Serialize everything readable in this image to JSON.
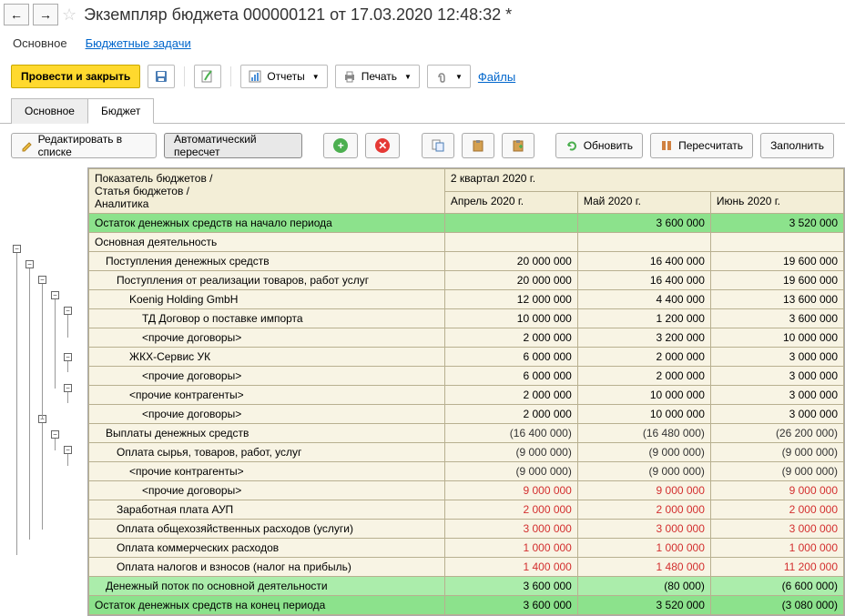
{
  "title": "Экземпляр бюджета 000000121 от 17.03.2020 12:48:32 *",
  "topNav": {
    "main": "Основное",
    "tasks": "Бюджетные задачи"
  },
  "toolbar1": {
    "submit": "Провести и закрыть",
    "reports": "Отчеты",
    "print": "Печать",
    "files": "Файлы"
  },
  "subTabs": {
    "main": "Основное",
    "budget": "Бюджет"
  },
  "toolbar2": {
    "editList": "Редактировать в списке",
    "autoRecalc": "Автоматический пересчет",
    "refresh": "Обновить",
    "recalc": "Пересчитать",
    "fill": "Заполнить"
  },
  "gridHeader": {
    "col1": "Показатель бюджетов /\nСтатья бюджетов /\nАналитика",
    "quarter": "2 квартал 2020 г.",
    "m1": "Апрель 2020 г.",
    "m2": "Май 2020 г.",
    "m3": "Июнь 2020 г."
  },
  "rows": [
    {
      "label": "Остаток денежных средств на начало периода",
      "cls": "row-green",
      "ind": 0,
      "v": [
        "",
        "3 600 000",
        "3 520 000"
      ]
    },
    {
      "label": "Основная деятельность",
      "cls": "row-beige",
      "ind": 0,
      "v": [
        "",
        "",
        ""
      ]
    },
    {
      "label": "Поступления денежных средств",
      "cls": "row-beige",
      "ind": 1,
      "v": [
        "20 000 000",
        "16 400 000",
        "19 600 000"
      ]
    },
    {
      "label": "Поступления от реализации товаров, работ услуг",
      "cls": "row-beige",
      "ind": 2,
      "v": [
        "20 000 000",
        "16 400 000",
        "19 600 000"
      ]
    },
    {
      "label": "Koenig Holding GmbH",
      "cls": "row-beige",
      "ind": 3,
      "v": [
        "12 000 000",
        "4 400 000",
        "13 600 000"
      ]
    },
    {
      "label": "ТД Договор о поставке импорта",
      "cls": "row-beige",
      "ind": 4,
      "v": [
        "10 000 000",
        "1 200 000",
        "3 600 000"
      ]
    },
    {
      "label": "<прочие договоры>",
      "cls": "row-beige",
      "ind": 4,
      "v": [
        "2 000 000",
        "3 200 000",
        "10 000 000"
      ]
    },
    {
      "label": "ЖКХ-Сервис УК",
      "cls": "row-beige",
      "ind": 3,
      "v": [
        "6 000 000",
        "2 000 000",
        "3 000 000"
      ]
    },
    {
      "label": "<прочие договоры>",
      "cls": "row-beige",
      "ind": 4,
      "v": [
        "6 000 000",
        "2 000 000",
        "3 000 000"
      ]
    },
    {
      "label": "<прочие контрагенты>",
      "cls": "row-beige",
      "ind": 3,
      "v": [
        "2 000 000",
        "10 000 000",
        "3 000 000"
      ]
    },
    {
      "label": "<прочие договоры>",
      "cls": "row-beige",
      "ind": 4,
      "v": [
        "2 000 000",
        "10 000 000",
        "3 000 000"
      ]
    },
    {
      "label": "Выплаты денежных средств",
      "cls": "row-beige",
      "ind": 1,
      "v": [
        "(16 400 000)",
        "(16 480 000)",
        "(26 200 000)"
      ],
      "neg": true
    },
    {
      "label": "Оплата сырья, товаров, работ, услуг",
      "cls": "row-beige",
      "ind": 2,
      "v": [
        "(9 000 000)",
        "(9 000 000)",
        "(9 000 000)"
      ],
      "neg": true
    },
    {
      "label": "<прочие контрагенты>",
      "cls": "row-beige",
      "ind": 3,
      "v": [
        "(9 000 000)",
        "(9 000 000)",
        "(9 000 000)"
      ],
      "neg": true
    },
    {
      "label": "<прочие договоры>",
      "cls": "row-beige",
      "ind": 4,
      "v": [
        "9 000 000",
        "9 000 000",
        "9 000 000"
      ],
      "red": true
    },
    {
      "label": "Заработная плата АУП",
      "cls": "row-beige",
      "ind": 2,
      "v": [
        "2 000 000",
        "2 000 000",
        "2 000 000"
      ],
      "red": true
    },
    {
      "label": "Оплата общехозяйственных расходов (услуги)",
      "cls": "row-beige",
      "ind": 2,
      "v": [
        "3 000 000",
        "3 000 000",
        "3 000 000"
      ],
      "red": true
    },
    {
      "label": "Оплата коммерческих расходов",
      "cls": "row-beige",
      "ind": 2,
      "v": [
        "1 000 000",
        "1 000 000",
        "1 000 000"
      ],
      "red": true
    },
    {
      "label": "Оплата налогов и взносов (налог на прибыль)",
      "cls": "row-beige",
      "ind": 2,
      "v": [
        "1 400 000",
        "1 480 000",
        "11 200 000"
      ],
      "red": true
    },
    {
      "label": "Денежный поток по основной деятельности",
      "cls": "row-lgreen",
      "ind": 1,
      "v": [
        "3 600 000",
        "(80 000)",
        "(6 600 000)"
      ]
    },
    {
      "label": "Остаток денежных средств на конец периода",
      "cls": "row-green",
      "ind": 0,
      "v": [
        "3 600 000",
        "3 520 000",
        "(3 080 000)"
      ]
    }
  ]
}
